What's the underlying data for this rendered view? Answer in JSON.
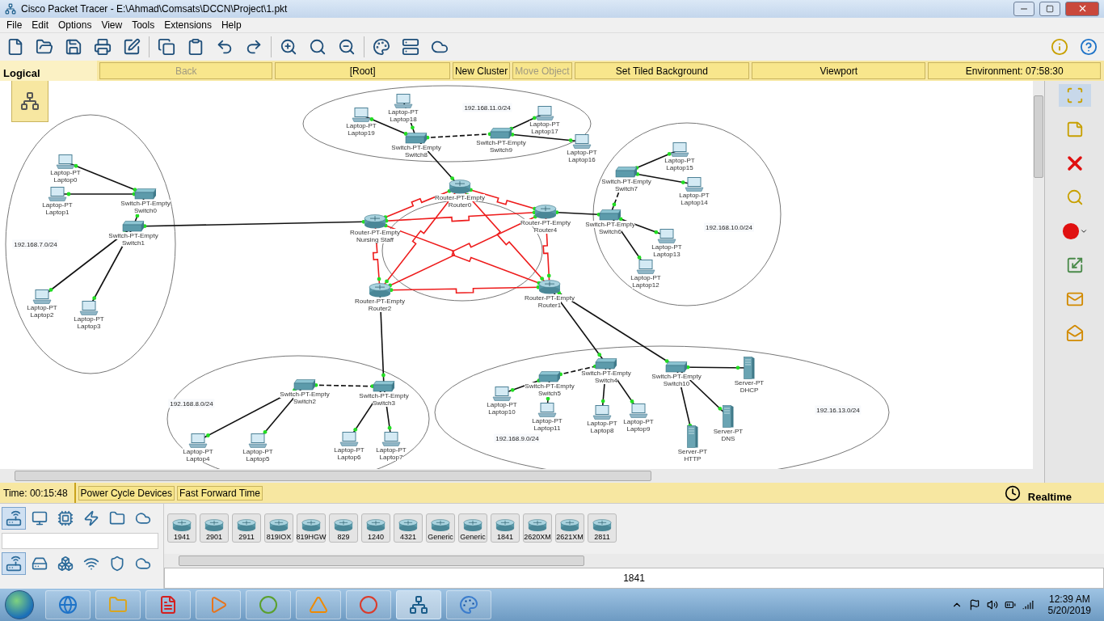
{
  "window": {
    "title": "Cisco Packet Tracer - E:\\Ahmad\\Comsats\\DCCN\\Project\\1.pkt"
  },
  "menu": [
    "File",
    "Edit",
    "Options",
    "View",
    "Tools",
    "Extensions",
    "Help"
  ],
  "nav": {
    "tab": {
      "label": "Logical",
      "selected": true
    },
    "buttons": [
      {
        "label": "Back",
        "disabled": true
      },
      {
        "label": "[Root]",
        "disabled": false
      },
      {
        "label": "New Cluster",
        "disabled": false
      },
      {
        "label": "Move Object",
        "disabled": true
      },
      {
        "label": "Set Tiled Background",
        "disabled": false
      },
      {
        "label": "Viewport",
        "disabled": false
      },
      {
        "label": "Environment: 07:58:30",
        "disabled": false
      }
    ]
  },
  "canvas": {
    "networks": [
      "192.168.11.0/24",
      "192.168.7.0/24",
      "192.168.10.0/24",
      "192.168.8.0/24",
      "192.168.9.0/24",
      "192.16.13.0/24"
    ],
    "devices": [
      {
        "kind": "laptop",
        "model": "Laptop-PT",
        "name": "Laptop19"
      },
      {
        "kind": "laptop",
        "model": "Laptop-PT",
        "name": "Laptop18"
      },
      {
        "kind": "switch",
        "model": "Switch-PT-Empty",
        "name": "Switch8"
      },
      {
        "kind": "switch",
        "model": "Switch-PT-Empty",
        "name": "Switch9"
      },
      {
        "kind": "laptop",
        "model": "Laptop-PT",
        "name": "Laptop17"
      },
      {
        "kind": "laptop",
        "model": "Laptop-PT",
        "name": "Laptop16"
      },
      {
        "kind": "laptop",
        "model": "Laptop-PT",
        "name": "Laptop0"
      },
      {
        "kind": "laptop",
        "model": "Laptop-PT",
        "name": "Laptop1"
      },
      {
        "kind": "switch",
        "model": "Switch-PT-Empty",
        "name": "Switch0"
      },
      {
        "kind": "switch",
        "model": "Switch-PT-Empty",
        "name": "Switch1"
      },
      {
        "kind": "laptop",
        "model": "Laptop-PT",
        "name": "Laptop2"
      },
      {
        "kind": "laptop",
        "model": "Laptop-PT",
        "name": "Laptop3"
      },
      {
        "kind": "switch",
        "model": "Switch-PT-Empty",
        "name": "Switch7"
      },
      {
        "kind": "laptop",
        "model": "Laptop-PT",
        "name": "Laptop15"
      },
      {
        "kind": "laptop",
        "model": "Laptop-PT",
        "name": "Laptop14"
      },
      {
        "kind": "switch",
        "model": "Switch-PT-Empty",
        "name": "Switch6"
      },
      {
        "kind": "laptop",
        "model": "Laptop-PT",
        "name": "Laptop13"
      },
      {
        "kind": "laptop",
        "model": "Laptop-PT",
        "name": "Laptop12"
      },
      {
        "kind": "router",
        "model": "Router-PT-Empty",
        "name": "Router0"
      },
      {
        "kind": "router",
        "model": "Router-PT-Empty",
        "name": "Nursing Staff"
      },
      {
        "kind": "router",
        "model": "Router-PT-Empty",
        "name": "Router4"
      },
      {
        "kind": "router",
        "model": "Router-PT-Empty",
        "name": "Router2"
      },
      {
        "kind": "router",
        "model": "Router-PT-Empty",
        "name": "Router1"
      },
      {
        "kind": "switch",
        "model": "Switch-PT-Empty",
        "name": "Switch2"
      },
      {
        "kind": "switch",
        "model": "Switch-PT-Empty",
        "name": "Switch3"
      },
      {
        "kind": "laptop",
        "model": "Laptop-PT",
        "name": "Laptop4"
      },
      {
        "kind": "laptop",
        "model": "Laptop-PT",
        "name": "Laptop5"
      },
      {
        "kind": "laptop",
        "model": "Laptop-PT",
        "name": "Laptop6"
      },
      {
        "kind": "laptop",
        "model": "Laptop-PT",
        "name": "Laptop7"
      },
      {
        "kind": "switch",
        "model": "Switch-PT-Empty",
        "name": "Switch5"
      },
      {
        "kind": "switch",
        "model": "Switch-PT-Empty",
        "name": "Switch4"
      },
      {
        "kind": "switch",
        "model": "Switch-PT-Empty",
        "name": "Switch10"
      },
      {
        "kind": "laptop",
        "model": "Laptop-PT",
        "name": "Laptop10"
      },
      {
        "kind": "laptop",
        "model": "Laptop-PT",
        "name": "Laptop11"
      },
      {
        "kind": "laptop",
        "model": "Laptop-PT",
        "name": "Laptop8"
      },
      {
        "kind": "laptop",
        "model": "Laptop-PT",
        "name": "Laptop9"
      },
      {
        "kind": "server",
        "model": "Server-PT",
        "name": "DHCP"
      },
      {
        "kind": "server",
        "model": "Server-PT",
        "name": "DNS"
      },
      {
        "kind": "server",
        "model": "Server-PT",
        "name": "HTTP"
      }
    ]
  },
  "sim_bar": {
    "time": "Time: 00:15:48",
    "buttons": [
      "Power Cycle Devices",
      "Fast Forward Time"
    ],
    "mode": "Realtime"
  },
  "device_panel": {
    "categories": [
      {
        "selected": true
      },
      {
        "selected": false
      },
      {
        "selected": false
      },
      {
        "selected": false
      },
      {
        "selected": false
      },
      {
        "selected": false
      }
    ],
    "subcategories": [
      {
        "selected": true
      },
      {
        "selected": false
      },
      {
        "selected": false
      },
      {
        "selected": false
      },
      {
        "selected": false
      },
      {
        "selected": false
      }
    ],
    "models": [
      "1941",
      "2901",
      "2911",
      "819IOX",
      "819HGW",
      "829",
      "1240",
      "4321",
      "Generic",
      "Generic",
      "1841",
      "2620XM",
      "2621XM",
      "2811"
    ],
    "model_caption": "1841"
  },
  "taskbar": {
    "time": "12:39 AM",
    "date": "5/20/2019"
  }
}
